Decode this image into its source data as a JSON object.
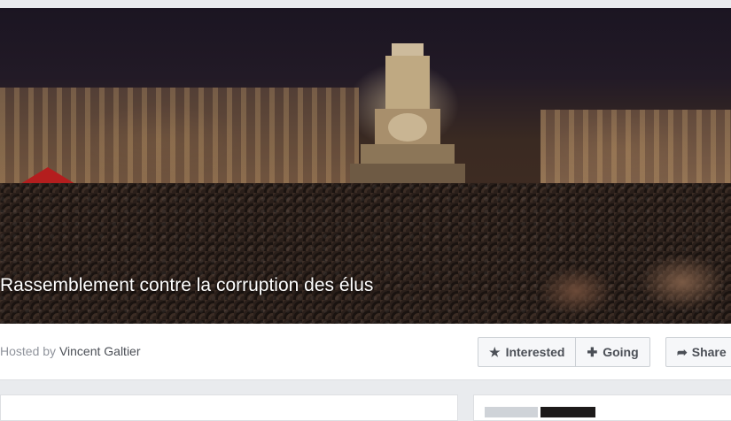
{
  "event": {
    "title": "Rassemblement contre la corruption des élus",
    "hosted_prefix": "Hosted by ",
    "host_name": "Vincent Galtier"
  },
  "actions": {
    "interested_label": "Interested",
    "going_label": "Going",
    "share_label": "Share"
  },
  "icons": {
    "interested": "star-icon",
    "going": "plus-icon",
    "share": "share-arrow-icon"
  },
  "colors": {
    "page_background": "#e9ebee",
    "button_text": "#4b4f56",
    "muted_text": "#90949c"
  }
}
